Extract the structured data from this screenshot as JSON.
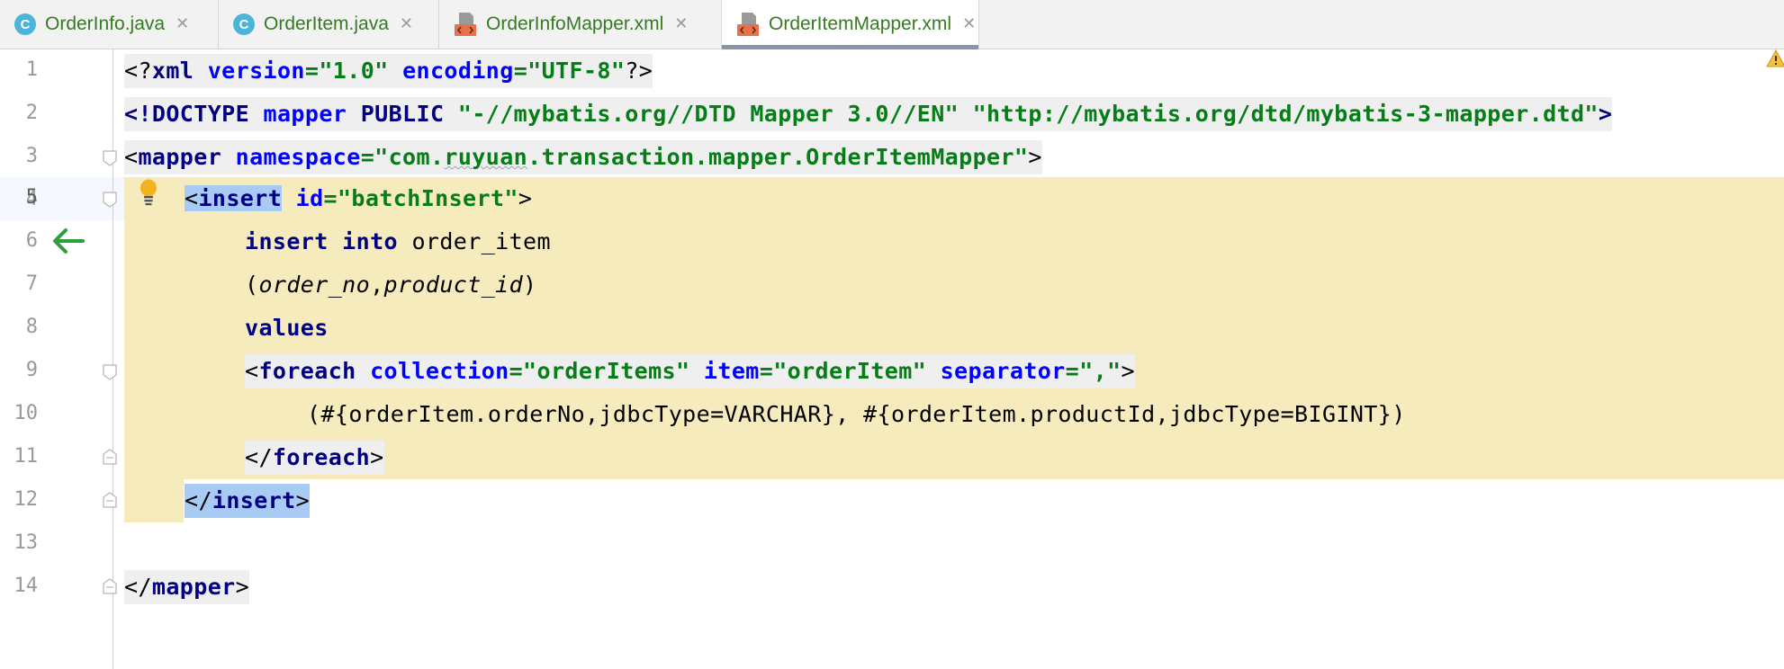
{
  "tabs": [
    {
      "label": "OrderInfo.java",
      "icon": "java-class-icon",
      "active": false
    },
    {
      "label": "OrderItem.java",
      "icon": "java-class-icon",
      "active": false
    },
    {
      "label": "OrderInfoMapper.xml",
      "icon": "xml-file-icon",
      "active": false
    },
    {
      "label": "OrderItemMapper.xml",
      "icon": "xml-file-icon",
      "active": true
    }
  ],
  "java_icon_letter": "C",
  "close_glyph": "✕",
  "editor": {
    "line_numbers": [
      "1",
      "2",
      "3",
      "4",
      "5",
      "6",
      "7",
      "8",
      "9",
      "10",
      "11",
      "12",
      "13",
      "14"
    ],
    "current_line": "5",
    "lines": {
      "l1": {
        "p1": "<?",
        "t": "xml",
        "a1": "version",
        "e1": "=",
        "s1": "\"1.0\"",
        "a2": "encoding",
        "e2": "=",
        "s2": "\"UTF-8\"",
        "p2": "?>"
      },
      "l2": {
        "p1": "<!",
        "t": "DOCTYPE",
        "n": "mapper",
        "k": "PUBLIC",
        "s1": "\"-//mybatis.org//DTD Mapper 3.0//EN\"",
        "s2": "\"http://mybatis.org/dtd/mybatis-3-mapper.dtd\"",
        "p2": ">"
      },
      "l3": {
        "p1": "<",
        "t": "mapper",
        "a": "namespace",
        "e": "=",
        "s_pre": "\"com.",
        "s_sq": "ruyuan",
        "s_post": ".transaction.mapper.OrderItemMapper\"",
        "p2": ">"
      },
      "l5": {
        "p1": "<",
        "t": "insert",
        "a": "id",
        "e": "=",
        "s": "\"batchInsert\"",
        "p2": ">"
      },
      "l6": {
        "k1": "insert",
        "k2": "into",
        "v": "order_item"
      },
      "l7": {
        "p1": "(",
        "c1": "order_no",
        "comma": ",",
        "c2": "product_id",
        "p2": ")"
      },
      "l8": {
        "k": "values"
      },
      "l9": {
        "p1": "<",
        "t": "foreach",
        "a1": "collection",
        "e1": "=",
        "s1": "\"orderItems\"",
        "a2": "item",
        "e2": "=",
        "s2": "\"orderItem\"",
        "a3": "separator",
        "e3": "=",
        "s3": "\",\"",
        "p2": ">"
      },
      "l10": {
        "text": "(#{orderItem.orderNo,jdbcType=VARCHAR}, #{orderItem.productId,jdbcType=BIGINT})"
      },
      "l11": {
        "p1": "</",
        "t": "foreach",
        "p2": ">"
      },
      "l12": {
        "p1": "</",
        "t": "insert",
        "p2": ">"
      },
      "l14": {
        "p1": "</",
        "t": "mapper",
        "p2": ">"
      }
    }
  },
  "colors": {
    "tag": "#000080",
    "attribute": "#0000ff",
    "string": "#067d17",
    "highlight_band": "#f5ebbd",
    "selection": "#a8cbf5",
    "tab_label": "#367a24"
  },
  "gutter_icons": {
    "navigate": "navigate-to-declaration-arrow-icon",
    "intention": "lightbulb-icon",
    "warning": "warning-icon"
  }
}
